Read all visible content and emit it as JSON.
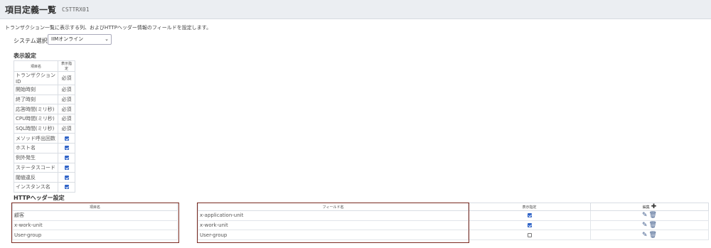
{
  "header": {
    "title": "項目定義一覧",
    "code": "CSTTRX01"
  },
  "description": "トランザクション一覧に表示する列、およびHTTPヘッダー情報のフィールドを設定します。",
  "system": {
    "label": "システム選択",
    "selected": "IIMオンライン"
  },
  "display_settings": {
    "title": "表示設定",
    "col_name": "項目名",
    "col_display": "表示指定",
    "rows": [
      {
        "name": "トランザクションID",
        "value": "必須"
      },
      {
        "name": "開始時刻",
        "value": "必須"
      },
      {
        "name": "終了時刻",
        "value": "必須"
      },
      {
        "name": "応答時間(ミリ秒)",
        "value": "必須"
      },
      {
        "name": "CPU時間(ミリ秒)",
        "value": "必須"
      },
      {
        "name": "SQL時間(ミリ秒)",
        "value": "必須"
      },
      {
        "name": "メソッド呼出回数",
        "checked": true
      },
      {
        "name": "ホスト名",
        "checked": true
      },
      {
        "name": "例外発生",
        "checked": true
      },
      {
        "name": "ステータスコード",
        "checked": true
      },
      {
        "name": "閾値違反",
        "checked": true
      },
      {
        "name": "インスタンス名",
        "checked": true
      }
    ]
  },
  "http_settings": {
    "title": "HTTPヘッダー設定",
    "col_name": "項目名",
    "col_field": "フィールド名",
    "col_display": "表示指定",
    "col_edit": "編集",
    "rows": [
      {
        "name": "顧客",
        "field": "x-application-unit",
        "checked": true
      },
      {
        "name": "x-work-unit",
        "field": "x-work-unit",
        "checked": true
      },
      {
        "name": "User-group",
        "field": "User-group",
        "checked": false
      }
    ]
  }
}
